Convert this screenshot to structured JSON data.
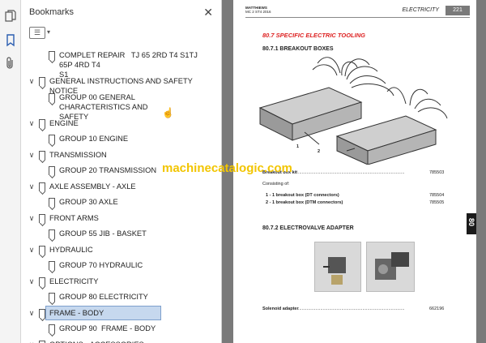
{
  "sidebar": {
    "icons": [
      "copy-pages-icon",
      "bookmark-icon",
      "attachment-icon"
    ]
  },
  "bookmarks": {
    "title": "Bookmarks",
    "close": "✕",
    "items": [
      {
        "label": "COMPLET REPAIR   TJ 65 2RD T4 S1TJ 65P 4RD T4\nS1",
        "level": 1,
        "caret": ""
      },
      {
        "label": "GENERAL INSTRUCTIONS AND SAFETY NOTICE",
        "level": 0,
        "caret": "∨"
      },
      {
        "label": "GROUP 00 GENERAL CHARACTERISTICS AND\nSAFETY",
        "level": 1,
        "caret": ""
      },
      {
        "label": "ENGINE",
        "level": 0,
        "caret": "∨"
      },
      {
        "label": "GROUP 10 ENGINE",
        "level": 1,
        "caret": ""
      },
      {
        "label": "TRANSMISSION",
        "level": 0,
        "caret": "∨"
      },
      {
        "label": "GROUP 20 TRANSMISSION",
        "level": 1,
        "caret": ""
      },
      {
        "label": "AXLE ASSEMBLY - AXLE",
        "level": 0,
        "caret": "∨"
      },
      {
        "label": "GROUP 30 AXLE",
        "level": 1,
        "caret": ""
      },
      {
        "label": "FRONT ARMS",
        "level": 0,
        "caret": "∨"
      },
      {
        "label": "GROUP 55 JIB - BASKET",
        "level": 1,
        "caret": ""
      },
      {
        "label": "HYDRAULIC",
        "level": 0,
        "caret": "∨"
      },
      {
        "label": "GROUP 70 HYDRAULIC",
        "level": 1,
        "caret": ""
      },
      {
        "label": "ELECTRICITY",
        "level": 0,
        "caret": "∨"
      },
      {
        "label": "GROUP 80 ELECTRICITY",
        "level": 1,
        "caret": ""
      },
      {
        "label": "FRAME - BODY",
        "level": 0,
        "caret": "∨",
        "selected": true
      },
      {
        "label": "GROUP 90  FRAME - BODY",
        "level": 1,
        "caret": ""
      },
      {
        "label": "OPTIONS - ACCESSORIES",
        "level": 0,
        "caret": "∨"
      }
    ]
  },
  "page": {
    "header_left_1": "MATTHIEWS",
    "header_left_2": "MC 2 ST4 2016",
    "header_title": "ELECTRICITY",
    "page_number": "221",
    "section": "80.7  SPECIFIC ELECTRIC TOOLING",
    "sub1": "80.7.1   BREAKOUT BOXES",
    "callout_1": "1",
    "callout_2": "2",
    "kit_label": "Breakout box kit",
    "kit_dots": "......................................................................................",
    "kit_code": "785503",
    "consisting": "Consisting of:",
    "item1": "1 -  1 breakout box (DT connectors)",
    "item1_code": "785504",
    "item2": "2 -  1 breakout box (DTM connectors)",
    "item2_code": "785505",
    "sub2": "80.7.2   ELECTROVALVE ADAPTER",
    "sol_label": "Solenoid adapter",
    "sol_dots": "......................................................................................",
    "sol_code": "662196",
    "side_tab": "80",
    "watermark": "machinecatalogic.com"
  }
}
